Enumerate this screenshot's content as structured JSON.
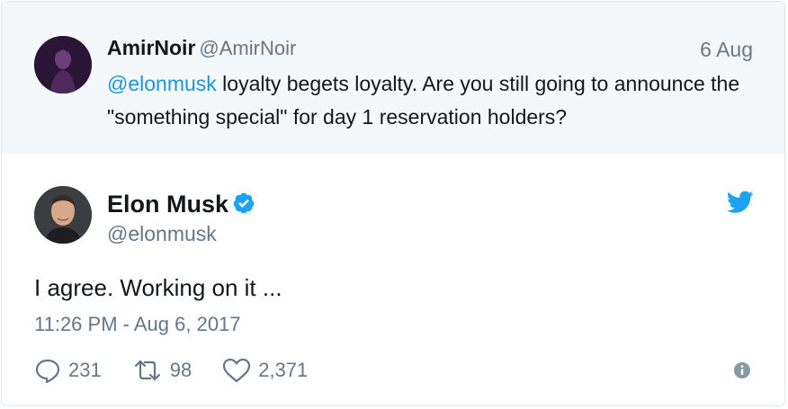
{
  "reply": {
    "display_name": "AmirNoir",
    "handle": "@AmirNoir",
    "date": "6 Aug",
    "mention": "@elonmusk",
    "text": " loyalty begets loyalty. Are you still going to announce the \"something special\" for day 1 reservation holders?"
  },
  "tweet": {
    "display_name": "Elon Musk",
    "handle": "@elonmusk",
    "text": "I agree. Working on it ...",
    "timestamp": "11:26 PM - Aug 6, 2017",
    "replies": "231",
    "retweets": "98",
    "likes": "2,371"
  },
  "icons": {
    "verified": "verified-badge-icon",
    "brand": "twitter-bird-icon",
    "reply": "reply-bubble-icon",
    "retweet": "retweet-icon",
    "like": "heart-icon",
    "info": "info-icon"
  },
  "colors": {
    "accent": "#1da1f2",
    "mention": "#1b95e0",
    "muted": "#657786",
    "reply_background": "#f5f8fa"
  }
}
